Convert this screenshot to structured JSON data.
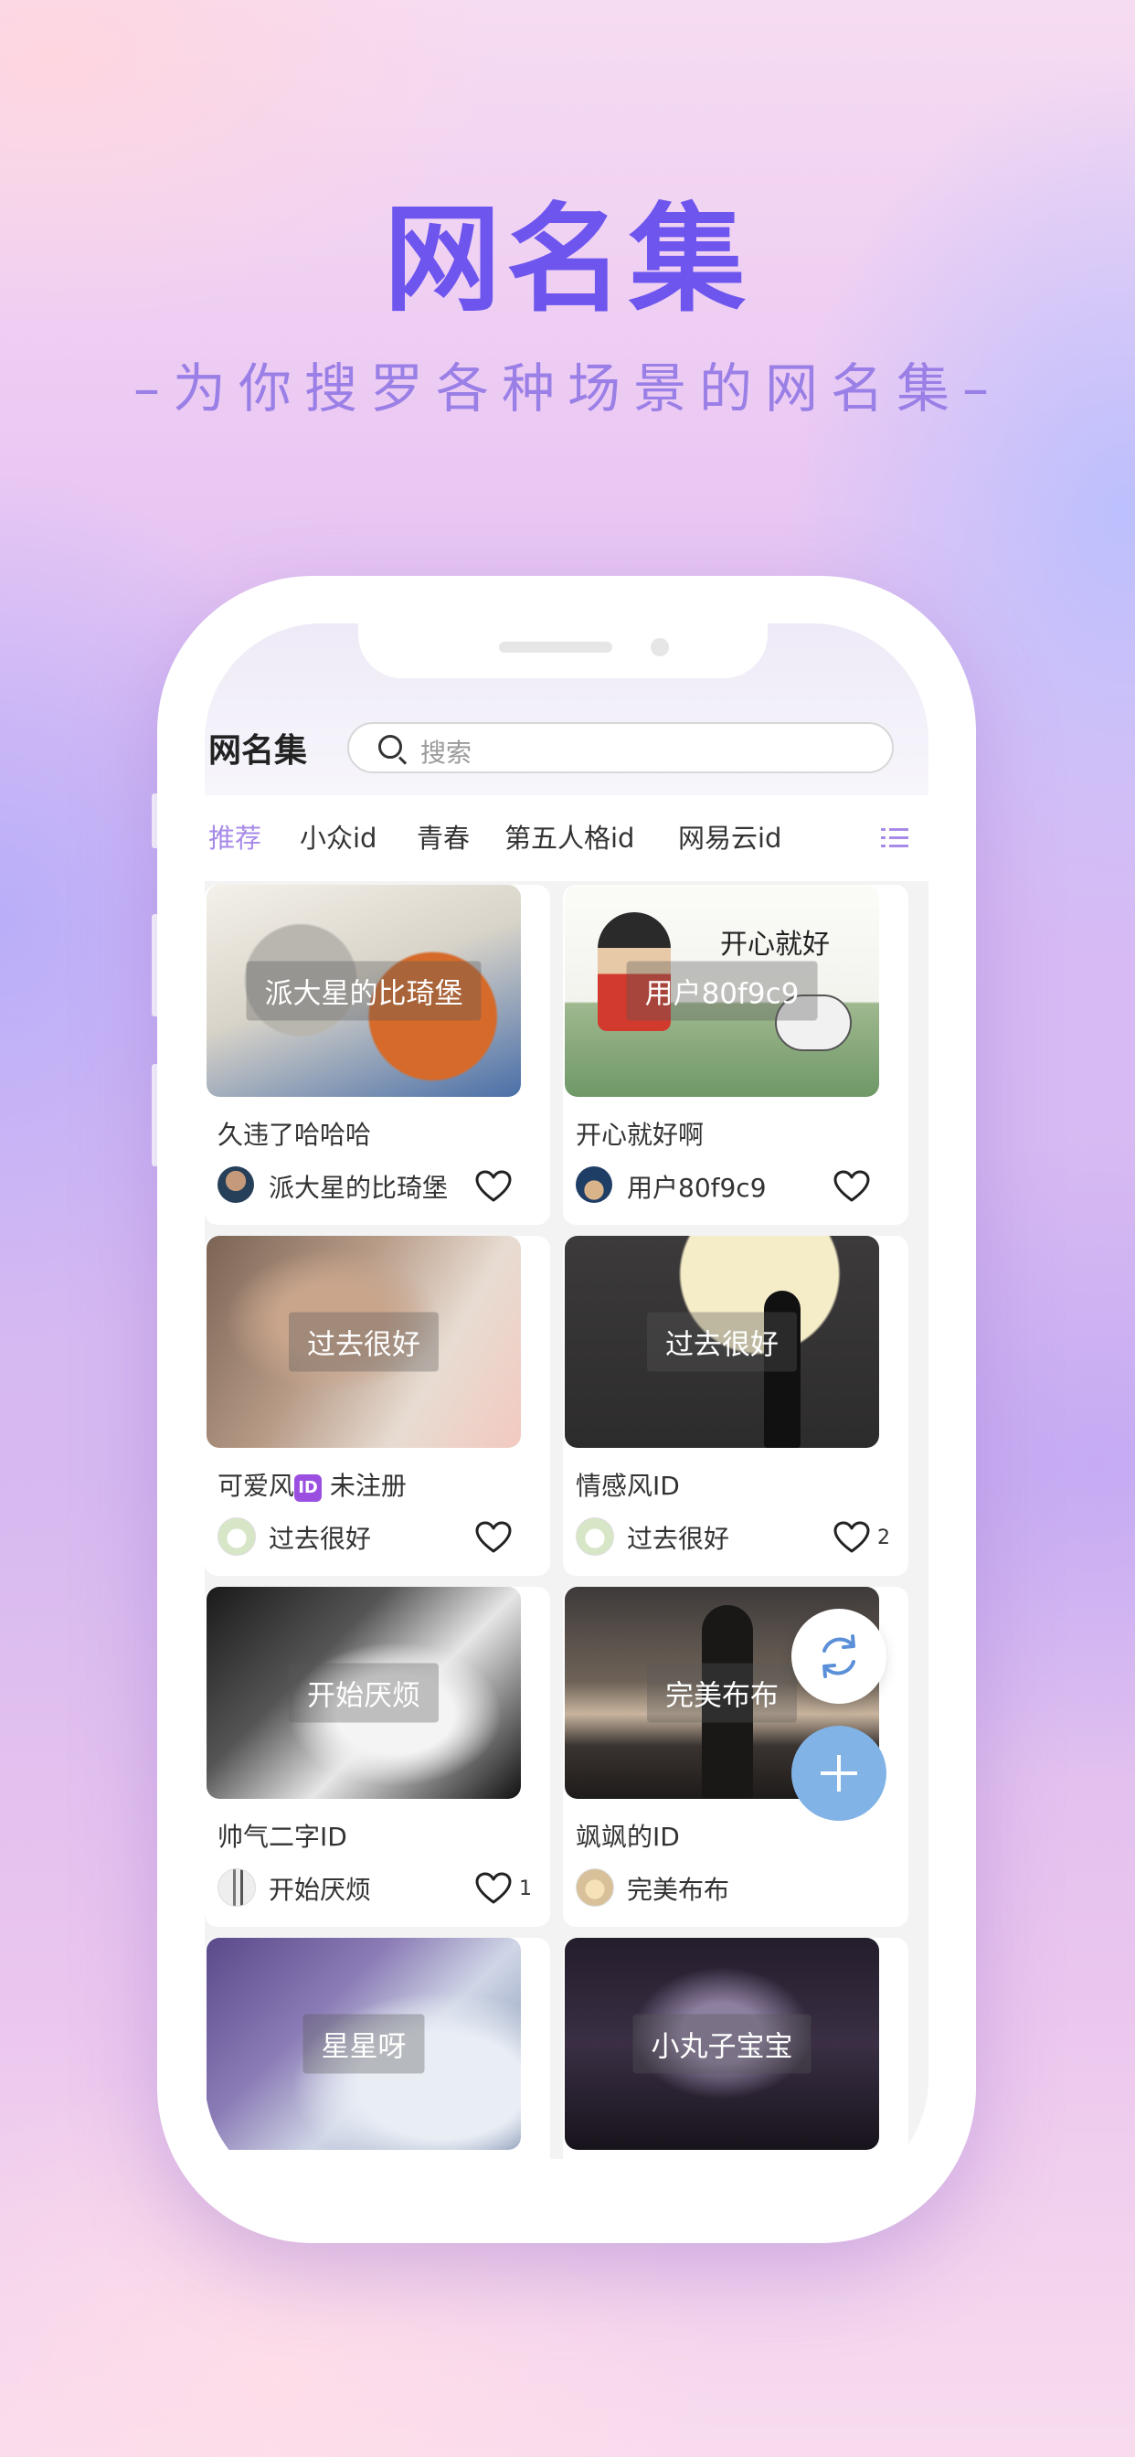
{
  "promo": {
    "headline": "网名集",
    "tagline": "–为你搜罗各种场景的网名集–"
  },
  "app": {
    "title": "网名集",
    "search_placeholder": "搜索"
  },
  "tabs": [
    {
      "label": "推荐",
      "active": true
    },
    {
      "label": "小众id",
      "active": false
    },
    {
      "label": "青春",
      "active": false
    },
    {
      "label": "第五人格id",
      "active": false
    },
    {
      "label": "网易云id",
      "active": false
    }
  ],
  "cards": [
    {
      "overlay": "派大星的比琦堡",
      "caption": "久违了哈哈哈",
      "user": "派大星的比琦堡",
      "likes": ""
    },
    {
      "overlay": "用户80f9c9",
      "caption": "开心就好啊",
      "user": "用户80f9c9",
      "likes": "",
      "image_text": "开心就好"
    },
    {
      "overlay": "过去很好",
      "caption_before": "可爱风",
      "caption_badge": "ID",
      "caption_after": "未注册",
      "user": "过去很好",
      "likes": ""
    },
    {
      "overlay": "过去很好",
      "caption": "情感风ID",
      "user": "过去很好",
      "likes": "2"
    },
    {
      "overlay": "开始厌烦",
      "caption": "帅气二字ID",
      "user": "开始厌烦",
      "likes": "1"
    },
    {
      "overlay": "完美布布",
      "caption": "飒飒的ID",
      "user": "完美布布",
      "likes": ""
    },
    {
      "overlay": "星星呀"
    },
    {
      "overlay": "小丸子宝宝"
    }
  ],
  "colors": {
    "accent": "#6d55ee",
    "tab_active": "#a78ae8",
    "fab": "#82b3e6"
  },
  "icons": [
    "search-icon",
    "menu-list-icon",
    "heart-icon",
    "refresh-icon",
    "plus-icon"
  ]
}
